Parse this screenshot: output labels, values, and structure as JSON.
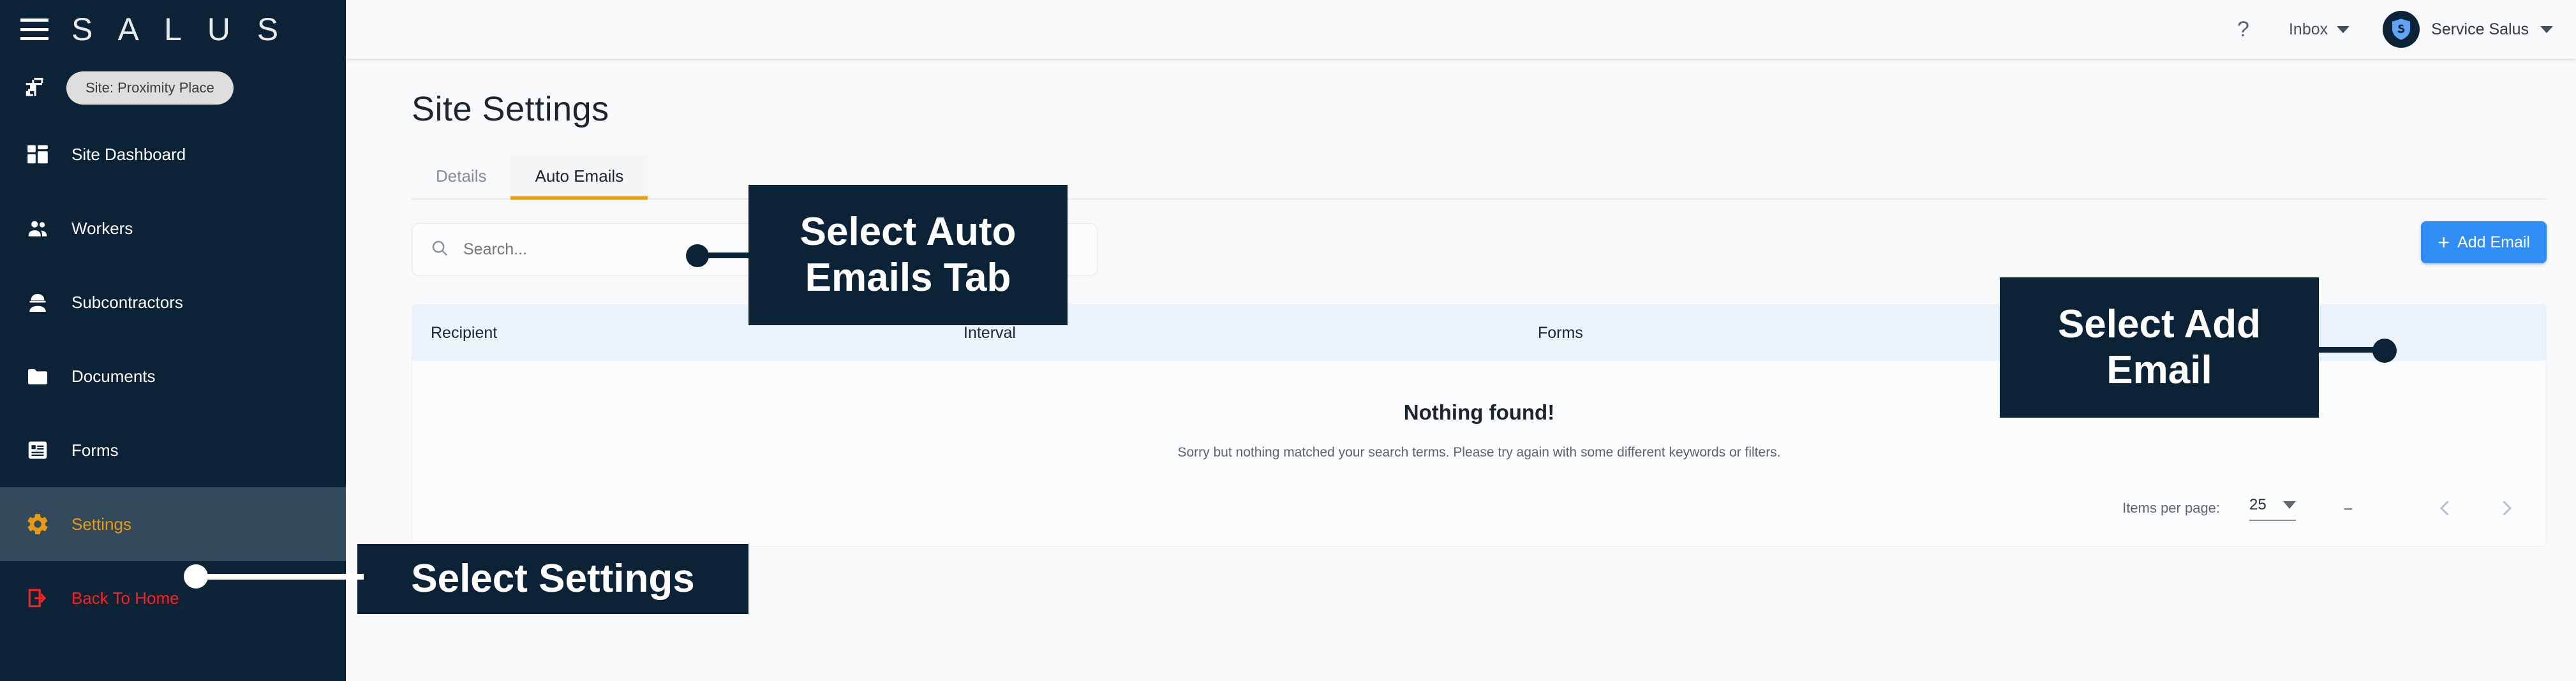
{
  "brand": {
    "name": "S A L U S",
    "menu_icon": "hamburger-icon"
  },
  "sidebar": {
    "site_chip": "Site: Proximity Place",
    "items": [
      {
        "label": "Site Dashboard",
        "icon": "dashboard-icon",
        "state": "default"
      },
      {
        "label": "Workers",
        "icon": "people-icon",
        "state": "default"
      },
      {
        "label": "Subcontractors",
        "icon": "hardhat-worker-icon",
        "state": "default"
      },
      {
        "label": "Documents",
        "icon": "folder-icon",
        "state": "default"
      },
      {
        "label": "Forms",
        "icon": "form-document-icon",
        "state": "default"
      },
      {
        "label": "Settings",
        "icon": "gear-icon",
        "state": "active"
      },
      {
        "label": "Back To Home",
        "icon": "logout-arrow-icon",
        "state": "danger"
      }
    ]
  },
  "topbar": {
    "help": "?",
    "inbox_label": "Inbox",
    "user_name": "Service Salus",
    "avatar_letter": "S"
  },
  "main": {
    "page_title": "Site Settings",
    "tabs": [
      {
        "label": "Details",
        "active": false
      },
      {
        "label": "Auto Emails",
        "active": true
      }
    ],
    "search": {
      "placeholder": "Search...",
      "value": "",
      "icon": "search-icon"
    },
    "add_button": {
      "label": "Add Email",
      "icon": "plus-icon"
    },
    "table": {
      "columns": [
        "Recipient",
        "Interval",
        "Forms"
      ],
      "rows": [],
      "empty_title": "Nothing found!",
      "empty_subtitle": "Sorry but nothing matched your search terms. Please try again with some different keywords or filters."
    },
    "paginator": {
      "items_per_page_label": "Items per page:",
      "items_per_page_value": "25",
      "range_label": "–",
      "prev_icon": "chevron-left-icon",
      "next_icon": "chevron-right-icon"
    }
  },
  "callouts": [
    {
      "text": "Select Auto Emails Tab",
      "id": "callout-auto-emails-tab"
    },
    {
      "text": "Select Add Email",
      "id": "callout-add-email"
    },
    {
      "text": "Select Settings",
      "id": "callout-settings"
    }
  ],
  "colors": {
    "sidebar_bg": "#0c2236",
    "accent_orange": "#e89a10",
    "danger_red": "#ff1f1f",
    "primary_blue": "#2f8df5",
    "table_header_bg": "#eaf2fc"
  }
}
